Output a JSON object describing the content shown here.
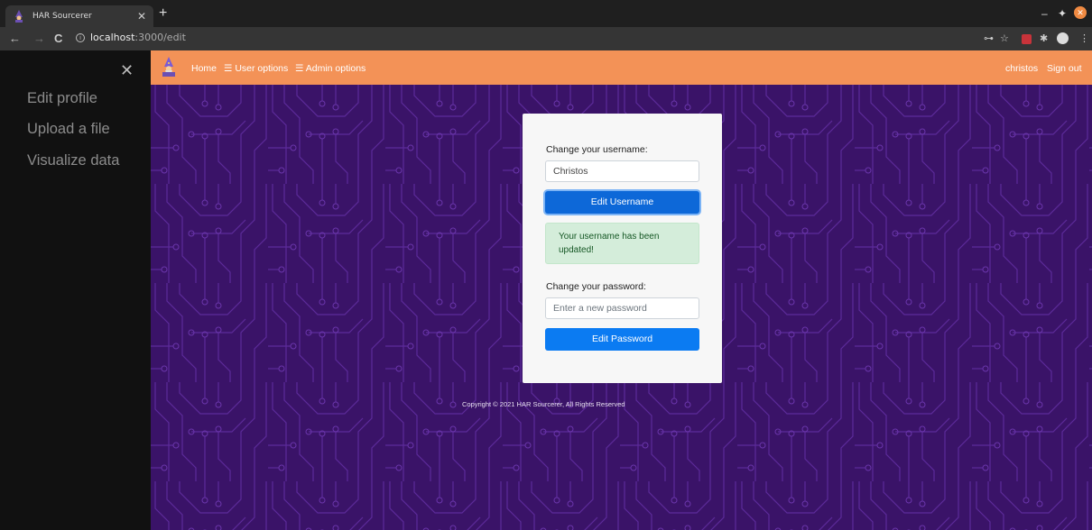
{
  "browser": {
    "tab_title": "HAR Sourcerer",
    "url_host": "localhost",
    "url_path": ":3000/edit"
  },
  "sidebar": {
    "items": [
      {
        "label": "Edit profile"
      },
      {
        "label": "Upload a file"
      },
      {
        "label": "Visualize data"
      }
    ]
  },
  "navbar": {
    "home": "Home",
    "user_options": "☰ User options",
    "admin_options": "☰ Admin options",
    "username": "christos",
    "sign_out": "Sign out"
  },
  "form": {
    "username_label": "Change your username:",
    "username_value": "Christos",
    "edit_username_button": "Edit Username",
    "success_message": "Your username has been updated!",
    "password_label": "Change your password:",
    "password_placeholder": "Enter a new password",
    "edit_password_button": "Edit Password"
  },
  "footer": {
    "copyright": "Copyright © 2021 HAR Sourcerer, All Rights Reserved"
  },
  "colors": {
    "navbar": "#f39257",
    "background": "#3a1368",
    "circuit_lines": "#5c2a9a",
    "primary_button": "#0b7bf2",
    "alert_bg": "#d4edda"
  },
  "icons": {
    "favicon": "wizard-icon",
    "logo": "wizard-icon",
    "sidebar_close": "close-icon"
  }
}
